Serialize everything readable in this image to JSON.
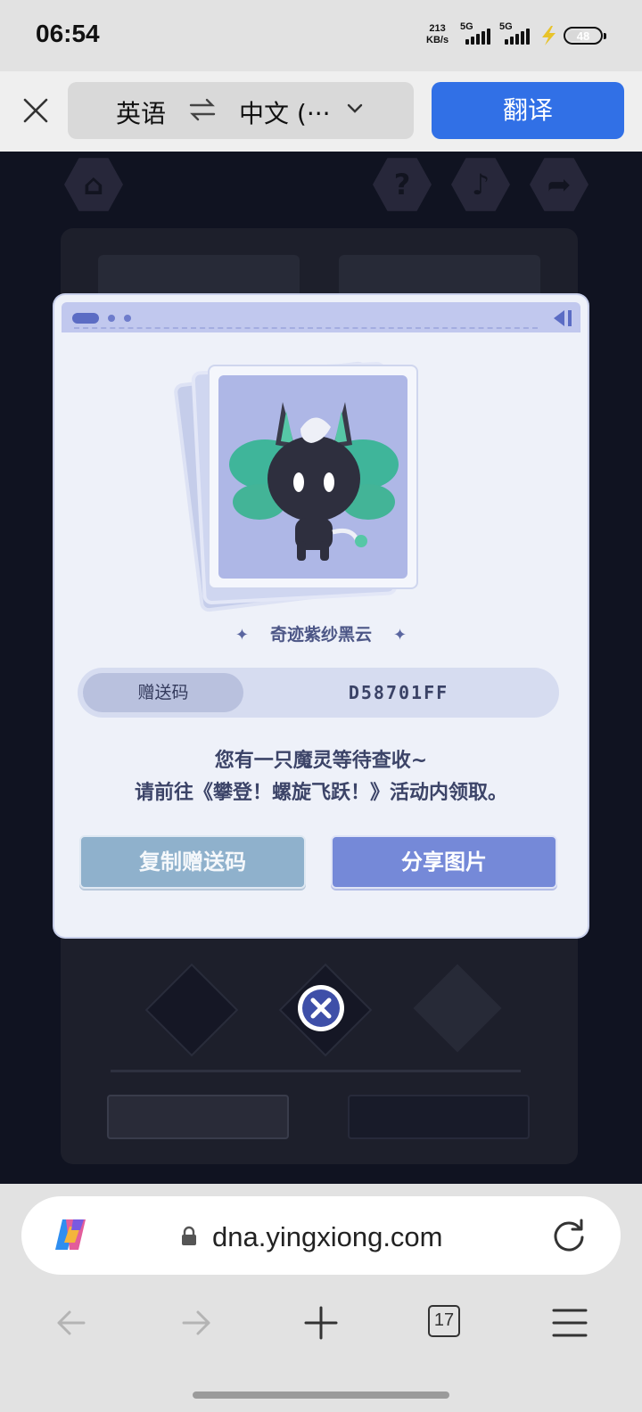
{
  "status_bar": {
    "time": "06:54",
    "net_speed_value": "213",
    "net_speed_unit": "KB/s",
    "sim1_label": "5G",
    "sim2_label": "5G",
    "battery": "48"
  },
  "translate_bar": {
    "source_language": "英语",
    "target_language": "中文 (···",
    "translate_label": "翻译"
  },
  "modal": {
    "pet_name": "奇迹紫纱黑云",
    "code_label": "赠送码",
    "code_value": "D58701FF",
    "message_line1": "您有一只魔灵等待查收~",
    "message_line2": "请前往《攀登！螺旋飞跃！》活动内领取。",
    "copy_button": "复制赠送码",
    "share_button": "分享图片"
  },
  "browser": {
    "url": "dna.yingxiong.com",
    "tab_count": "17"
  },
  "colors": {
    "accent_blue": "#3170e6",
    "copy_button": "#8fb1cc",
    "share_button": "#7589d8",
    "modal_bg": "#eef1f9"
  }
}
